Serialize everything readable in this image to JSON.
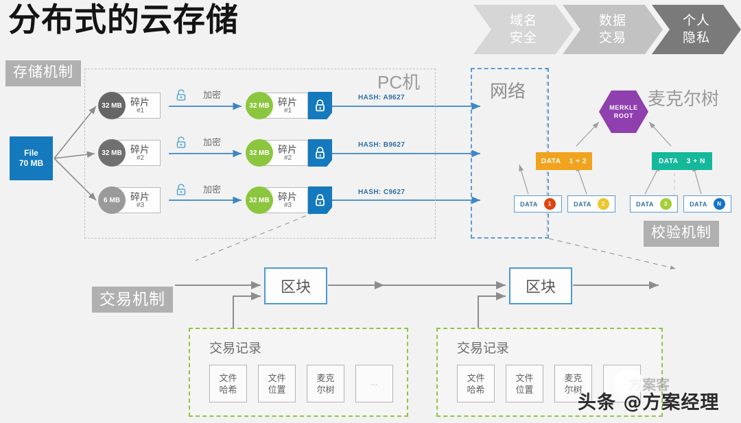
{
  "title": "分布式的云存储",
  "badges": {
    "storage": "存储机制",
    "verify": "校验机制",
    "transaction": "交易机制"
  },
  "chevrons": [
    {
      "label_line1": "域名",
      "label_line2": "安全",
      "color": "#d6d6d6"
    },
    {
      "label_line1": "数据",
      "label_line2": "交易",
      "color": "#c2c2c2"
    },
    {
      "label_line1": "个人",
      "label_line2": "隐私",
      "color": "#7a7a7a"
    }
  ],
  "regions": {
    "pc_label": "PC机",
    "network_label": "网络",
    "merkle_label": "麦克尔树"
  },
  "file": {
    "name": "File",
    "size": "70 MB",
    "color": "#1479bd"
  },
  "raw_chunks": [
    {
      "size": "32 MB",
      "label": "碎片",
      "index": "#1",
      "color": "#666666"
    },
    {
      "size": "32 MB",
      "label": "碎片",
      "index": "#2",
      "color": "#707070"
    },
    {
      "size": "6 MB",
      "label": "碎片",
      "index": "#3",
      "color": "#9a9a9a"
    }
  ],
  "encrypt_labels": [
    "加密",
    "加密",
    "加密"
  ],
  "encrypted_chunks": [
    {
      "size": "32 MB",
      "label": "碎片",
      "index": "#1",
      "color": "#8cc63f"
    },
    {
      "size": "32 MB",
      "label": "碎片",
      "index": "#2",
      "color": "#8cc63f"
    },
    {
      "size": "32 MB",
      "label": "碎片",
      "index": "#3",
      "color": "#8cc63f"
    }
  ],
  "hashes": [
    "HASH: A9627",
    "HASH: B9627",
    "HASH: C9627"
  ],
  "merkle": {
    "root": {
      "line1": "MERKLE",
      "line2": "ROOT",
      "color": "#8f3fae"
    },
    "mid": [
      {
        "label": "DATA",
        "value": "1 + 2",
        "color": "#f1a31d"
      },
      {
        "label": "DATA",
        "value": "3 + N",
        "color": "#14b89a"
      }
    ],
    "leaves": [
      {
        "label": "DATA",
        "value": "1",
        "color": "#e0450f"
      },
      {
        "label": "DATA",
        "value": "2",
        "color": "#ecc72c"
      },
      {
        "label": "DATA",
        "value": "3",
        "color": "#a6ce39"
      },
      {
        "label": "DATA",
        "value": "N",
        "color": "#1574c4"
      }
    ]
  },
  "blocks": [
    {
      "label": "区块"
    },
    {
      "label": "区块"
    }
  ],
  "tx_records": [
    {
      "title": "交易记录",
      "cells": [
        {
          "line1": "文件",
          "line2": "哈希"
        },
        {
          "line1": "文件",
          "line2": "位置"
        },
        {
          "line1": "麦克",
          "line2": "尔树"
        },
        {
          "line1": "...",
          "line2": ""
        }
      ]
    },
    {
      "title": "交易记录",
      "cells": [
        {
          "line1": "文件",
          "line2": "哈希"
        },
        {
          "line1": "文件",
          "line2": "位置"
        },
        {
          "line1": "麦克",
          "line2": "尔树"
        },
        {
          "line1": "...",
          "line2": ""
        }
      ]
    }
  ],
  "watermark": {
    "text": "头条 @方案经理",
    "faint_text": "方案客"
  }
}
